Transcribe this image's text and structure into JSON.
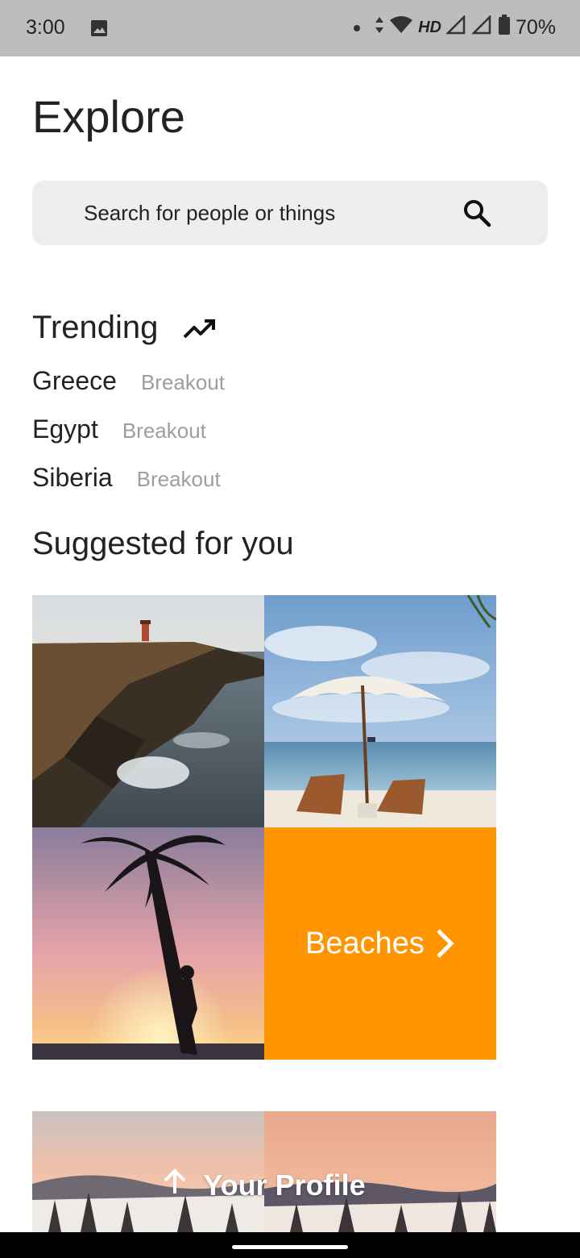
{
  "status_bar": {
    "time": "3:00",
    "network": "HD",
    "battery": "70%"
  },
  "page": {
    "title": "Explore"
  },
  "search": {
    "placeholder": "Search for people or things"
  },
  "trending": {
    "title": "Trending",
    "items": [
      {
        "name": "Greece",
        "tag": "Breakout"
      },
      {
        "name": "Egypt",
        "tag": "Breakout"
      },
      {
        "name": "Siberia",
        "tag": "Breakout"
      }
    ]
  },
  "suggested": {
    "title": "Suggested for you",
    "category_label": "Beaches",
    "accent_color": "#ff9500"
  },
  "profile": {
    "label": "Your Profile"
  }
}
